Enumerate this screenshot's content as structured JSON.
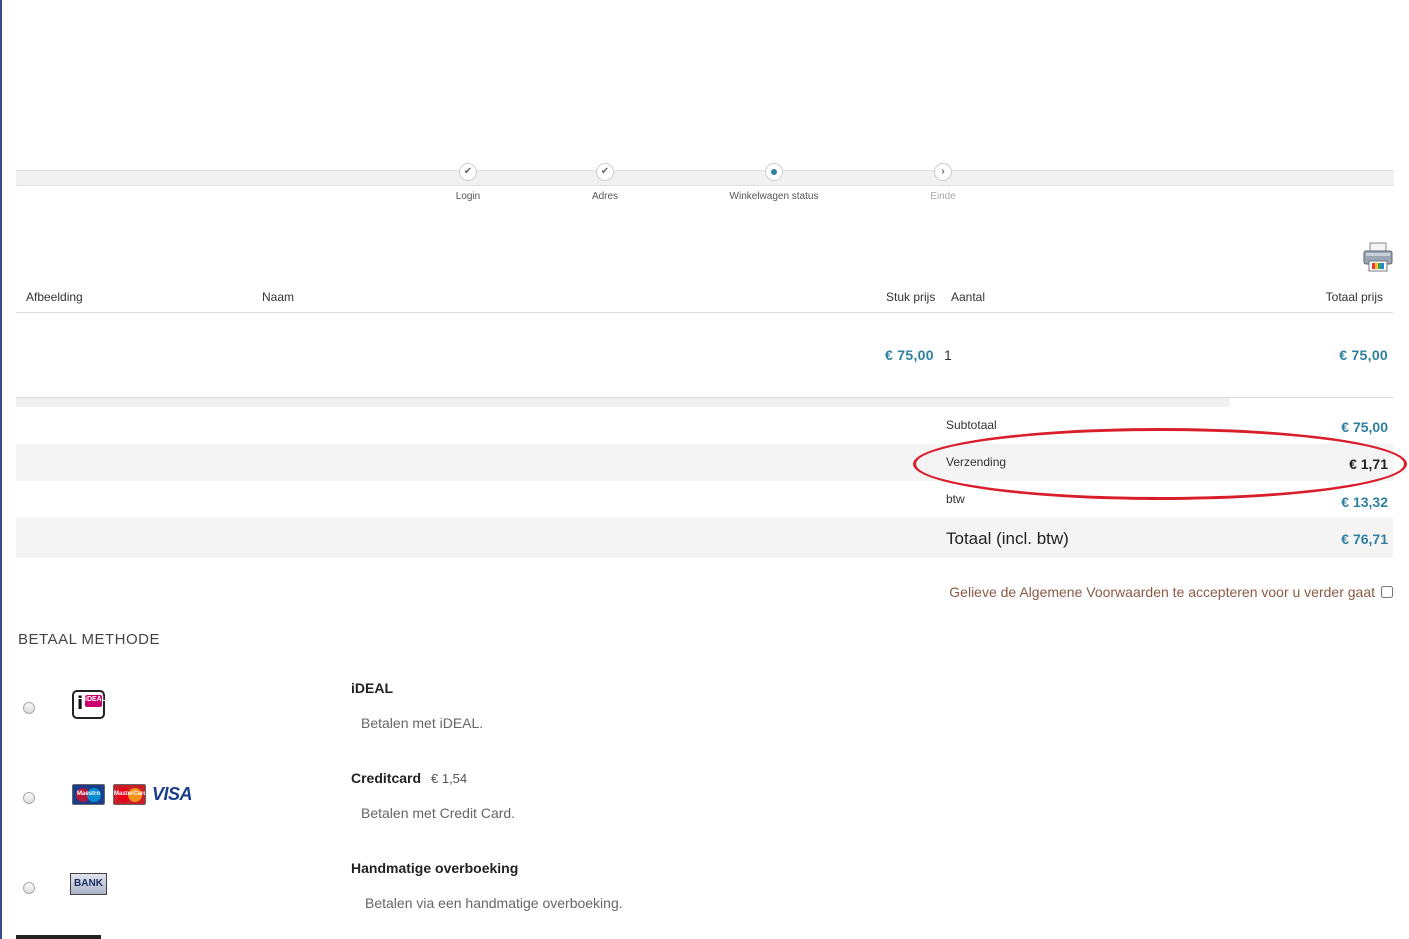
{
  "steps": [
    {
      "label": "Login",
      "state": "done"
    },
    {
      "label": "Adres",
      "state": "done"
    },
    {
      "label": "Winkelwagen status",
      "state": "current"
    },
    {
      "label": "Einde",
      "state": "upcoming"
    }
  ],
  "table": {
    "headers": {
      "image": "Afbeelding",
      "name": "Naam",
      "unit_price": "Stuk prijs",
      "quantity": "Aantal",
      "total_price": "Totaal prijs"
    },
    "rows": [
      {
        "unit_price": "€ 75,00",
        "quantity": "1",
        "total_price": "€ 75,00"
      }
    ]
  },
  "summary": {
    "subtotal_label": "Subtotaal",
    "subtotal_value": "€ 75,00",
    "shipping_label": "Verzending",
    "shipping_value": "€ 1,71",
    "vat_label": "btw",
    "vat_value": "€ 13,32",
    "total_label": "Totaal (incl. btw)",
    "total_value": "€ 76,71"
  },
  "terms_text": "Gelieve de Algemene Voorwaarden te accepteren voor u verder gaat",
  "payment": {
    "section_title": "BETAAL METHODE",
    "methods": [
      {
        "title": "iDEAL",
        "fee": "",
        "description": "Betalen met iDEAL.",
        "logo_text": "iDEAL"
      },
      {
        "title": "Creditcard",
        "fee": "€ 1,54",
        "description": "Betalen met Credit Card.",
        "logo_text": [
          "Maestro",
          "MasterCard",
          "VISA"
        ]
      },
      {
        "title": "Handmatige overboeking",
        "fee": "",
        "description": "Betalen via een handmatige overboeking.",
        "logo_text": "BANK"
      }
    ]
  },
  "colors": {
    "accent_price": "#2f7f9f",
    "highlight": "#d81e2a",
    "terms_text": "#8a5a44"
  },
  "icons": [
    "check-icon",
    "dot-icon",
    "chevron-right-icon",
    "printer-icon",
    "ideal-logo",
    "maestro-logo",
    "mastercard-logo",
    "visa-logo",
    "bank-logo"
  ]
}
